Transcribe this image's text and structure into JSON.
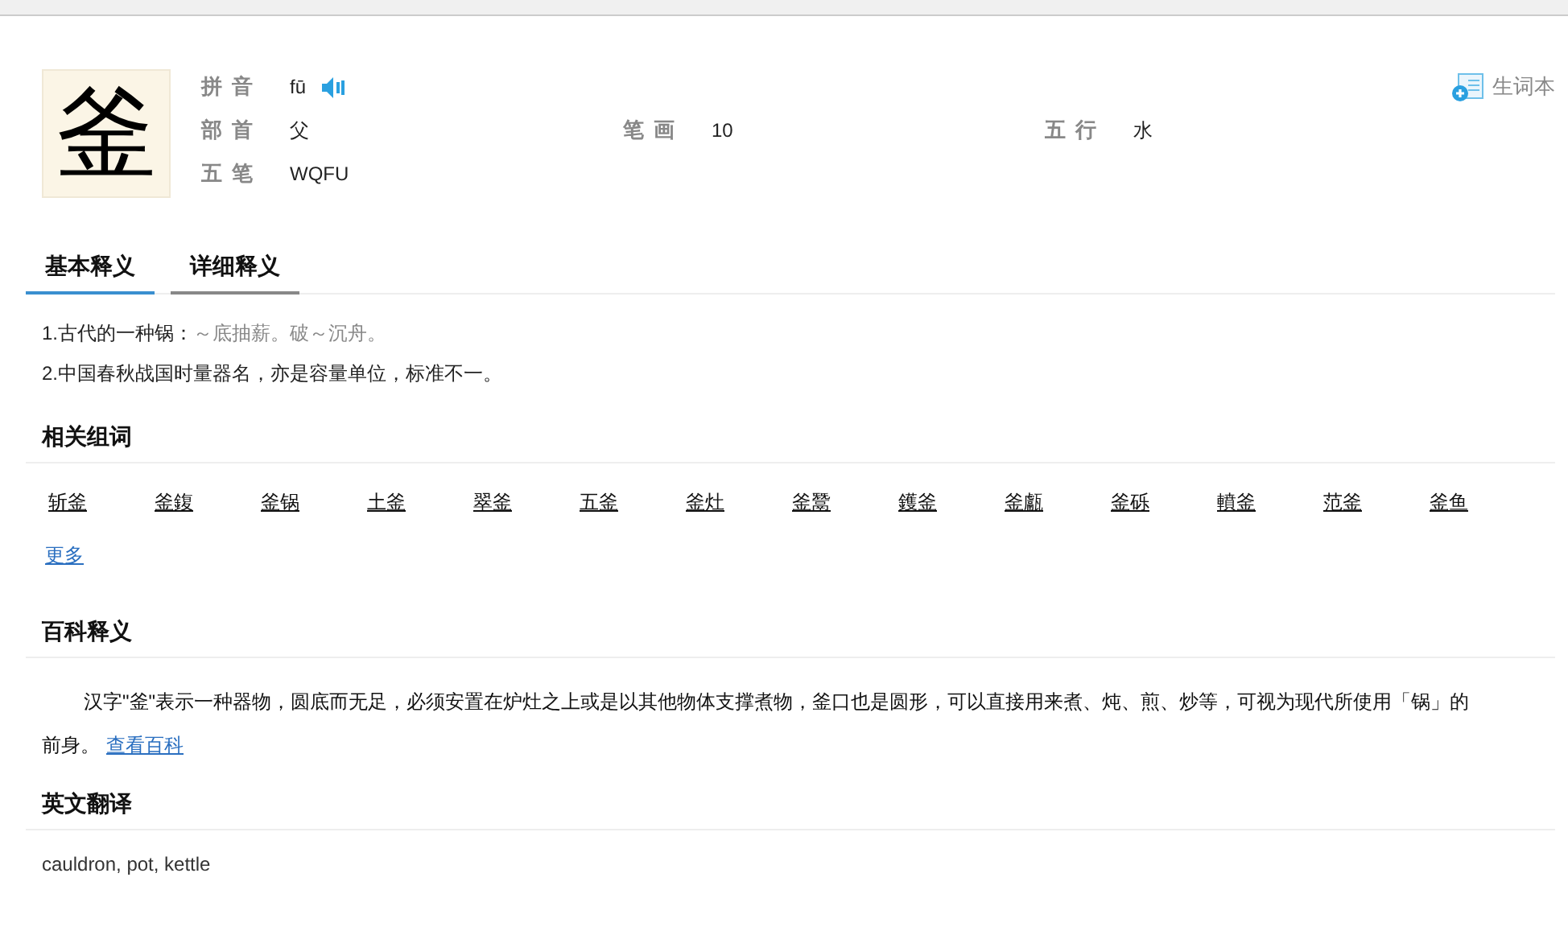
{
  "character": "釜",
  "info": [
    {
      "label": "拼音",
      "value": "fū",
      "kind": "pinyin"
    },
    {
      "label": "部首",
      "value": "父",
      "kind": "plain"
    },
    {
      "label": "笔画",
      "value": "10",
      "kind": "plain"
    },
    {
      "label": "五行",
      "value": "水",
      "kind": "plain"
    },
    {
      "label": "五笔",
      "value": "WQFU",
      "kind": "plain"
    }
  ],
  "wordbook": "生词本",
  "tabs": [
    {
      "label": "基本释义",
      "selected": true
    },
    {
      "label": "详细释义",
      "selected": false
    }
  ],
  "definitions": [
    {
      "number": "1.",
      "text": "古代的一种锅：",
      "example": "～底抽薪。破～沉舟。"
    },
    {
      "number": "2.",
      "text": "中国春秋战国时量器名，亦是容量单位，标准不一。"
    }
  ],
  "related": {
    "title": "相关组词",
    "words": [
      "斩釜",
      "釜鍑",
      "釜锅",
      "土釜",
      "翠釜",
      "五釜",
      "釜灶",
      "釜鬵",
      "鑊釜",
      "釜甗",
      "釜砾",
      "轒釜",
      "范釜",
      "釜鱼"
    ],
    "more": "更多"
  },
  "baike": {
    "title": "百科释义",
    "text": "汉字\"釜\"表示一种器物，圆底而无足，必须安置在炉灶之上或是以其他物体支撑煮物，釜口也是圆形，可以直接用来煮、炖、煎、炒等，可视为现代所使用「锅」的前身。",
    "link": "查看百科"
  },
  "english": {
    "title": "英文翻译",
    "text": "cauldron, pot, kettle"
  }
}
